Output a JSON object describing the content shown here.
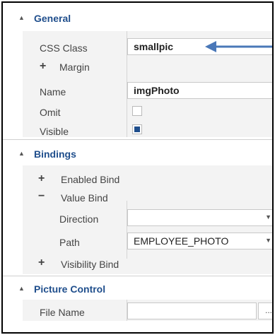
{
  "general": {
    "header": "General",
    "css_class_label": "CSS Class",
    "css_class_value": "smallpic",
    "margin_label": "Margin",
    "name_label": "Name",
    "name_value": "imgPhoto",
    "omit_label": "Omit",
    "omit_checked": false,
    "visible_label": "Visible",
    "visible_checked": true
  },
  "bindings": {
    "header": "Bindings",
    "enabled_bind_label": "Enabled Bind",
    "value_bind_label": "Value Bind",
    "direction_label": "Direction",
    "direction_value": "",
    "path_label": "Path",
    "path_value": "EMPLOYEE_PHOTO",
    "visibility_bind_label": "Visibility Bind"
  },
  "picture_control": {
    "header": "Picture Control",
    "file_name_label": "File Name",
    "file_name_value": "",
    "browse_label": "..."
  },
  "annotation": {
    "arrow_color": "#4a78b8"
  },
  "colors": {
    "accent": "#1f4e8c",
    "panel_bg": "#f3f3f3"
  },
  "icons": {
    "collapse": "collapse-triangle-icon",
    "expand": "plus-icon",
    "collapse_bind": "minus-icon",
    "dropdown": "chevron-down-icon"
  }
}
